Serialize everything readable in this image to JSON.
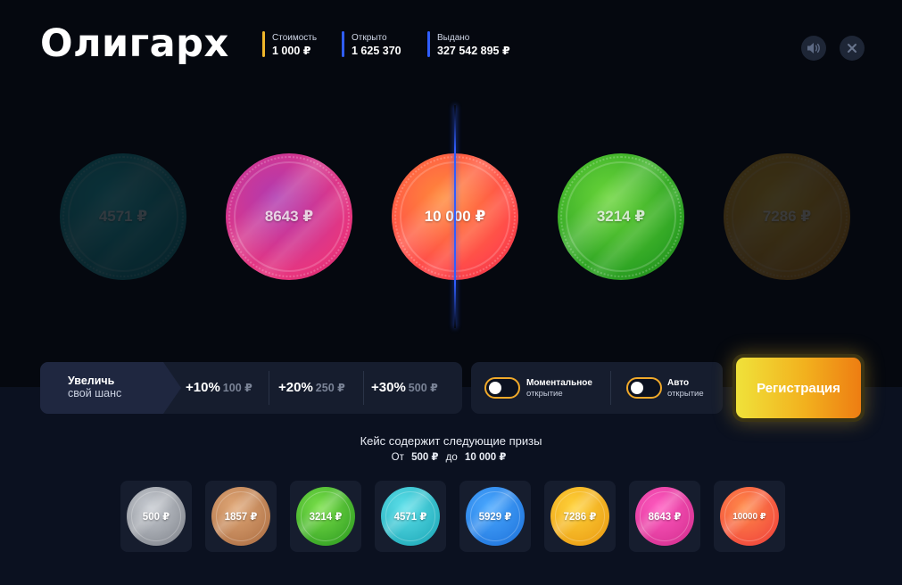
{
  "header": {
    "title": "Олигарх",
    "stats": [
      {
        "label": "Стоимость",
        "value": "1 000 ₽",
        "color": "#f0b62a"
      },
      {
        "label": "Открыто",
        "value": "1 625 370",
        "color": "#2f5dff"
      },
      {
        "label": "Выдано",
        "value": "327 542 895 ₽",
        "color": "#2f5dff"
      }
    ],
    "icons": [
      "speaker-icon",
      "close-icon"
    ]
  },
  "roulette": {
    "coins": [
      {
        "amount": "4571 ₽",
        "color": "#1aa6b0",
        "dimmed": true
      },
      {
        "amount": "8643 ₽",
        "color": "#e83fa0",
        "dimmed": false
      },
      {
        "amount": "10 000 ₽",
        "color": "#ff5a4a",
        "dimmed": false
      },
      {
        "amount": "3214 ₽",
        "color": "#3fbf2a",
        "dimmed": false
      },
      {
        "amount": "7286 ₽",
        "color": "#e8a21e",
        "dimmed": true
      }
    ]
  },
  "chance": {
    "label_line1": "Увеличь",
    "label_line2": "свой шанс",
    "options": [
      {
        "pct": "+10%",
        "cost": "100 ₽"
      },
      {
        "pct": "+20%",
        "cost": "250 ₽"
      },
      {
        "pct": "+30%",
        "cost": "500 ₽"
      }
    ]
  },
  "toggles": [
    {
      "line1": "Моментальное",
      "line2": "открытие"
    },
    {
      "line1": "Авто",
      "line2": "открытие"
    }
  ],
  "register_button": "Регистрация",
  "prizes": {
    "title": "Кейс содержит следующие призы",
    "from_label": "От",
    "from_value": "500 ₽",
    "to_label": "до",
    "to_value": "10 000 ₽",
    "items": [
      {
        "amount": "500 ₽",
        "color": "#9a9ea6"
      },
      {
        "amount": "1857 ₽",
        "color": "#c98a5a"
      },
      {
        "amount": "3214 ₽",
        "color": "#3fbf2a"
      },
      {
        "amount": "4571 ₽",
        "color": "#26c4d2"
      },
      {
        "amount": "5929 ₽",
        "color": "#2a8ef0"
      },
      {
        "amount": "7286 ₽",
        "color": "#f2b01e"
      },
      {
        "amount": "8643 ₽",
        "color": "#ee3fa8"
      },
      {
        "amount": "10000 ₽",
        "color": "#ff5a4a"
      }
    ]
  }
}
